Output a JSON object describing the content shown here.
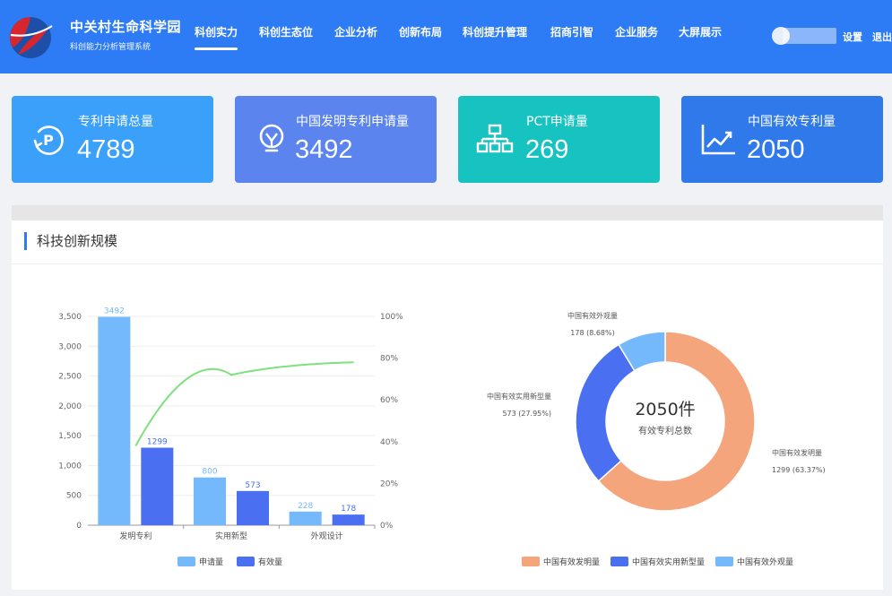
{
  "header": {
    "brand_title": "中关村生命科学园",
    "brand_subtitle": "科创能力分析管理系统",
    "nav": [
      {
        "label": "科创实力",
        "active": true
      },
      {
        "label": "科创生态位",
        "active": false
      },
      {
        "label": "企业分析",
        "active": false
      },
      {
        "label": "创新布局",
        "active": false
      },
      {
        "label": "科创提升管理",
        "active": false
      },
      {
        "label": "招商引智",
        "active": false
      },
      {
        "label": "企业服务",
        "active": false
      },
      {
        "label": "大屏展示",
        "active": false
      }
    ],
    "settings_label": "设置",
    "logout_label": "退出"
  },
  "stats": [
    {
      "label": "专利申请总量",
      "value": "4789",
      "color": "#3aa0fa",
      "icon": "patent-p-icon"
    },
    {
      "label": "中国发明专利申请量",
      "value": "3492",
      "color": "#5b84ef",
      "icon": "lightbulb-icon"
    },
    {
      "label": "PCT申请量",
      "value": "269",
      "color": "#17c3c0",
      "icon": "org-chart-icon"
    },
    {
      "label": "中国有效专利量",
      "value": "2050",
      "color": "#2f79ea",
      "icon": "trend-chart-icon"
    }
  ],
  "panel": {
    "title": "科技创新规模"
  },
  "chart_data": [
    {
      "type": "bar",
      "categories": [
        "发明专利",
        "实用新型",
        "外观设计"
      ],
      "series": [
        {
          "name": "申请量",
          "values": [
            3492,
            800,
            228
          ],
          "color": "#74b9fb"
        },
        {
          "name": "有效量",
          "values": [
            1299,
            573,
            178
          ],
          "color": "#4a6ff0"
        }
      ],
      "line": {
        "values": [
          0.38,
          0.72,
          0.78
        ],
        "color": "#7ee07e",
        "axis": "right"
      },
      "y_ticks": [
        "0",
        "500",
        "1,000",
        "1,500",
        "2,000",
        "2,500",
        "3,000",
        "3,500"
      ],
      "ylim": [
        0,
        3500
      ],
      "y2_ticks": [
        "0%",
        "20%",
        "40%",
        "60%",
        "80%",
        "100%"
      ],
      "y2lim": [
        0,
        1
      ]
    },
    {
      "type": "pie",
      "center_value": "2050件",
      "center_label": "有效专利总数",
      "slices": [
        {
          "name": "中国有效发明量",
          "value": 1299,
          "pct": "63.37%",
          "color": "#f4a57c"
        },
        {
          "name": "中国有效实用新型量",
          "value": 573,
          "pct": "27.95%",
          "color": "#4a6ff0"
        },
        {
          "name": "中国有效外观量",
          "value": 178,
          "pct": "8.68%",
          "color": "#74b9fb"
        }
      ]
    }
  ]
}
